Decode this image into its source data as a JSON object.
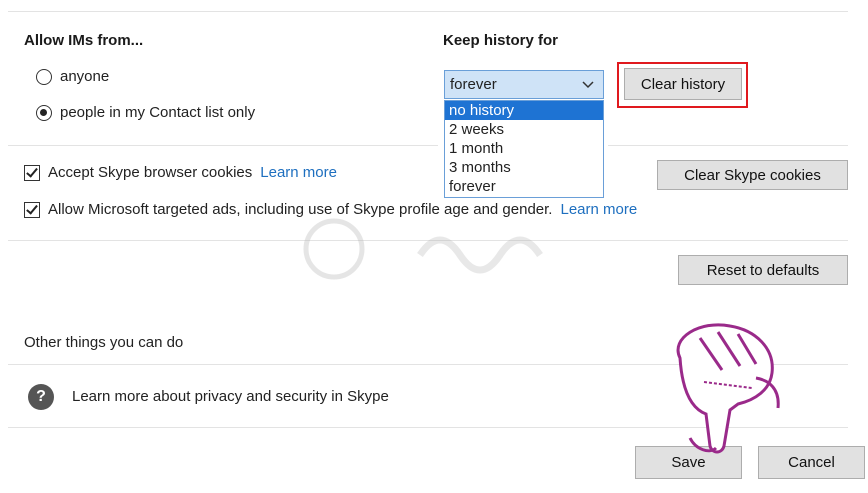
{
  "ims": {
    "heading": "Allow IMs from...",
    "options": [
      "anyone",
      "people in my Contact list only"
    ],
    "selected_index": 1
  },
  "history": {
    "heading": "Keep history for",
    "selected_value": "forever",
    "options": [
      "no history",
      "2 weeks",
      "1 month",
      "3 months",
      "forever"
    ],
    "highlighted_option": "no history",
    "clear_button": "Clear history"
  },
  "cookies": {
    "label": "Accept Skype browser cookies",
    "learn_more": "Learn more",
    "checked": true,
    "clear_button": "Clear Skype cookies"
  },
  "ads": {
    "label": "Allow Microsoft targeted ads, including use of Skype profile age and gender.",
    "learn_more": "Learn more",
    "checked": true
  },
  "reset_button": "Reset to defaults",
  "other": {
    "heading": "Other things you can do",
    "privacy_link": "Learn more about privacy and security in Skype"
  },
  "footer": {
    "save": "Save",
    "cancel": "Cancel"
  },
  "icons": {
    "help": "question-circle-icon",
    "chevron": "chevron-down-icon",
    "pointer": "pointing-hand-icon"
  },
  "colors": {
    "link": "#1e6fbf",
    "highlight_box": "#e0191e",
    "dropdown_selected": "#1e73d3",
    "pointer_hand": "#9a2a8a"
  }
}
